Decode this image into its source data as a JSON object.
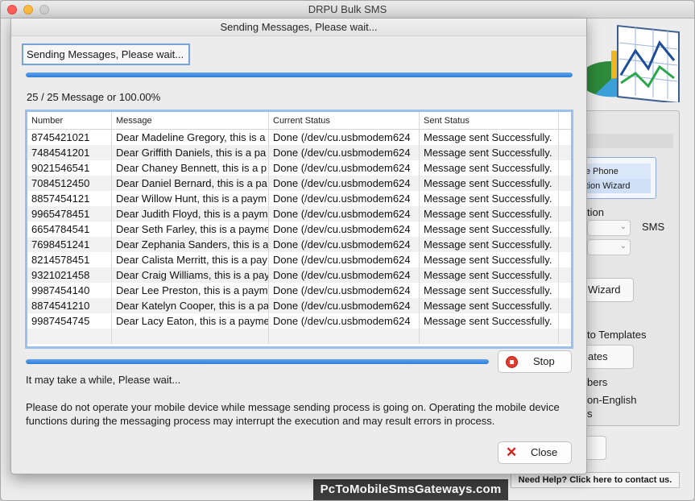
{
  "window": {
    "title": "DRPU Bulk SMS"
  },
  "background": {
    "colon": ":",
    "mode_line1": "ile Phone",
    "mode_line2": "ction  Wizard",
    "option_label": "tion",
    "sms_label": "SMS",
    "wizard_button": "Wizard",
    "templates_label": "to Templates",
    "templates_button": "ates",
    "numbers_label": "bers",
    "non_english_label_1": "on-English",
    "non_english_label_2": "s",
    "help_link": "Need Help? Click here to contact us.",
    "watermark": "PcToMobileSmsGateways.com"
  },
  "dialog": {
    "title": "Sending Messages, Please wait...",
    "status_text": "Sending Messages, Please wait...",
    "top_progress": 1.0,
    "count_text": "25 / 25 Message or 100.00%",
    "bottom_progress": 1.0,
    "stop_label": "Stop",
    "wait_text": "It may take a while, Please wait...",
    "warning_text": "Please do not operate your mobile device while message sending process is going on. Operating the mobile device functions during the messaging process may interrupt the execution and may result errors in process.",
    "close_label": "Close"
  },
  "table": {
    "columns": [
      "Number",
      "Message",
      "Current Status",
      "Sent Status"
    ],
    "rows": [
      [
        "8745421021",
        "Dear Madeline Gregory, this is a",
        "Done (/dev/cu.usbmodem624",
        "Message sent Successfully."
      ],
      [
        "7484541201",
        "Dear Griffith Daniels, this is a pa",
        "Done (/dev/cu.usbmodem624",
        "Message sent Successfully."
      ],
      [
        "9021546541",
        "Dear Chaney Bennett, this is a p",
        "Done (/dev/cu.usbmodem624",
        "Message sent Successfully."
      ],
      [
        "7084512450",
        "Dear Daniel Bernard, this is a pa",
        "Done (/dev/cu.usbmodem624",
        "Message sent Successfully."
      ],
      [
        "8857454121",
        "Dear Willow Hunt, this is a paym",
        "Done (/dev/cu.usbmodem624",
        "Message sent Successfully."
      ],
      [
        "9965478451",
        "Dear Judith Floyd, this is a paym",
        "Done (/dev/cu.usbmodem624",
        "Message sent Successfully."
      ],
      [
        "6654784541",
        "Dear Seth Farley, this is a payme",
        "Done (/dev/cu.usbmodem624",
        "Message sent Successfully."
      ],
      [
        "7698451241",
        "Dear Zephania Sanders, this is a",
        "Done (/dev/cu.usbmodem624",
        "Message sent Successfully."
      ],
      [
        "8214578451",
        "Dear Calista Merritt, this is a pay",
        "Done (/dev/cu.usbmodem624",
        "Message sent Successfully."
      ],
      [
        "9321021458",
        "Dear Craig Williams, this is a pay",
        "Done (/dev/cu.usbmodem624",
        "Message sent Successfully."
      ],
      [
        "9987454140",
        "Dear Lee Preston, this is a paym",
        "Done (/dev/cu.usbmodem624",
        "Message sent Successfully."
      ],
      [
        "8874541210",
        "Dear Katelyn Cooper, this is a pa",
        "Done (/dev/cu.usbmodem624",
        "Message sent Successfully."
      ],
      [
        "9987454745",
        "Dear Lacy Eaton, this is a payme",
        "Done (/dev/cu.usbmodem624",
        "Message sent Successfully."
      ]
    ]
  }
}
